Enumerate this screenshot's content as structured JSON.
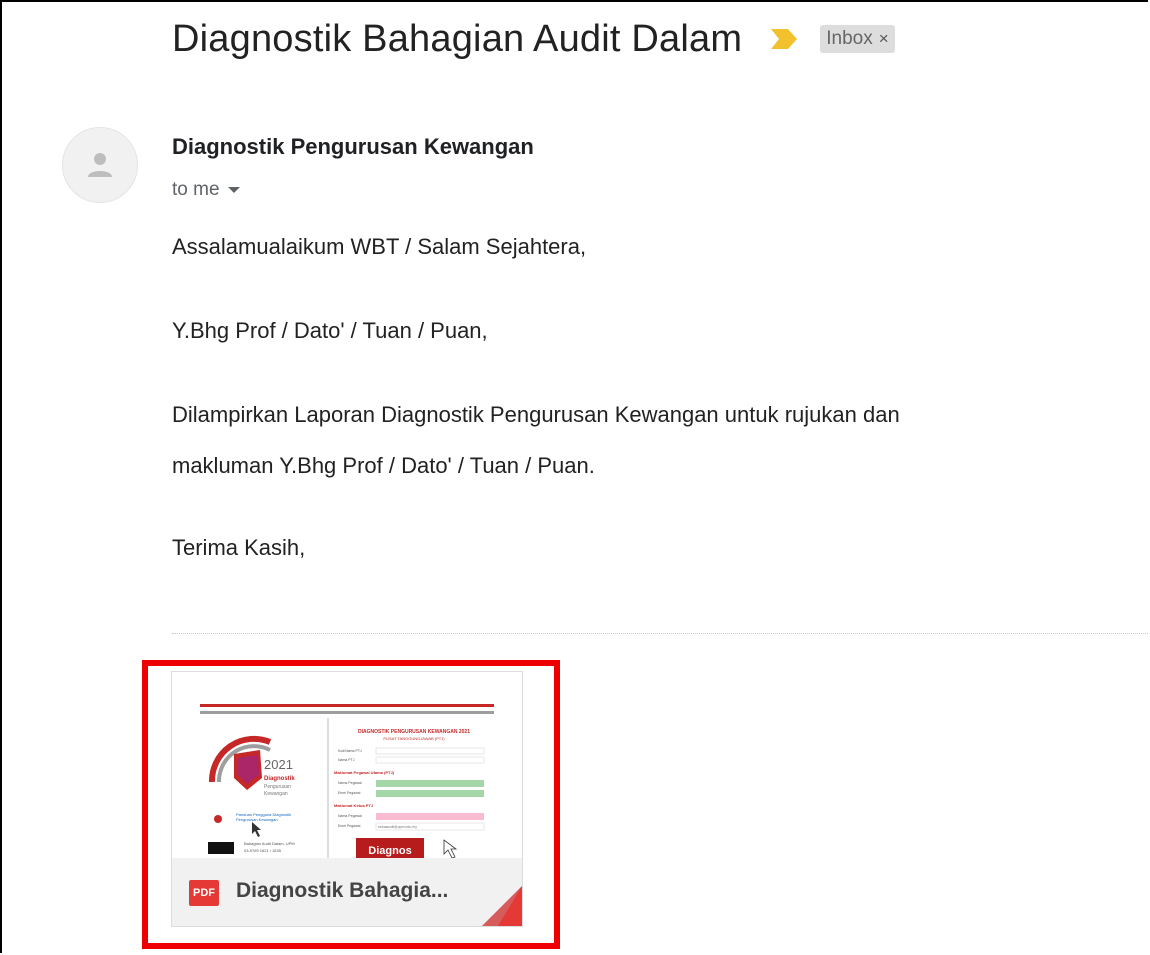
{
  "email": {
    "subject": "Diagnostik Bahagian Audit Dalam",
    "label": "Inbox",
    "label_remove": "×",
    "sender": "Diagnostik Pengurusan Kewangan",
    "recipient": "to me",
    "body": [
      "Assalamualaikum WBT / Salam Sejahtera,",
      "Y.Bhg Prof / Dato' / Tuan / Puan,",
      "Dilampirkan Laporan Diagnostik Pengurusan Kewangan untuk rujukan dan",
      "makluman Y.Bhg Prof / Dato' / Tuan / Puan.",
      "Terima Kasih,"
    ]
  },
  "attachment": {
    "type_badge": "PDF",
    "name": "Diagnostik Bahagia...",
    "preview": {
      "logo_year": "2021",
      "logo_title": "Diagnostik",
      "logo_sub1": "Pengurusan",
      "logo_sub2": "Kewangan",
      "form_title": "DIAGNOSTIK PENGURUSAN KEWANGAN 2021",
      "form_subtitle": "PUSAT TANGGUNGJAWAB (PTJ)",
      "link_text1": "Panduan Pengguna Diagnostik",
      "link_text2": "Pengurusan Kewangan",
      "contact1": "Bahagian Audit Dalam, UPM",
      "contact2": "03-9769 1621 / 1635",
      "field_labels": [
        "Kod/Nama PTJ",
        "Nama PTJ",
        "Maklumat Pegawai Utama (PTJ)",
        "Nama Pegawai",
        "Emel Pegawai",
        "Maklumat Ketua PTJ",
        "Nama Pegawai",
        "Emel Pegawai"
      ],
      "email_value": "ketuaaudit@upm.edu.my",
      "button": "Diagnos"
    }
  },
  "colors": {
    "importance": "#f2c12e",
    "pdf": "#e53935",
    "highlight": "#ee0000",
    "brand_red": "#c62828"
  }
}
